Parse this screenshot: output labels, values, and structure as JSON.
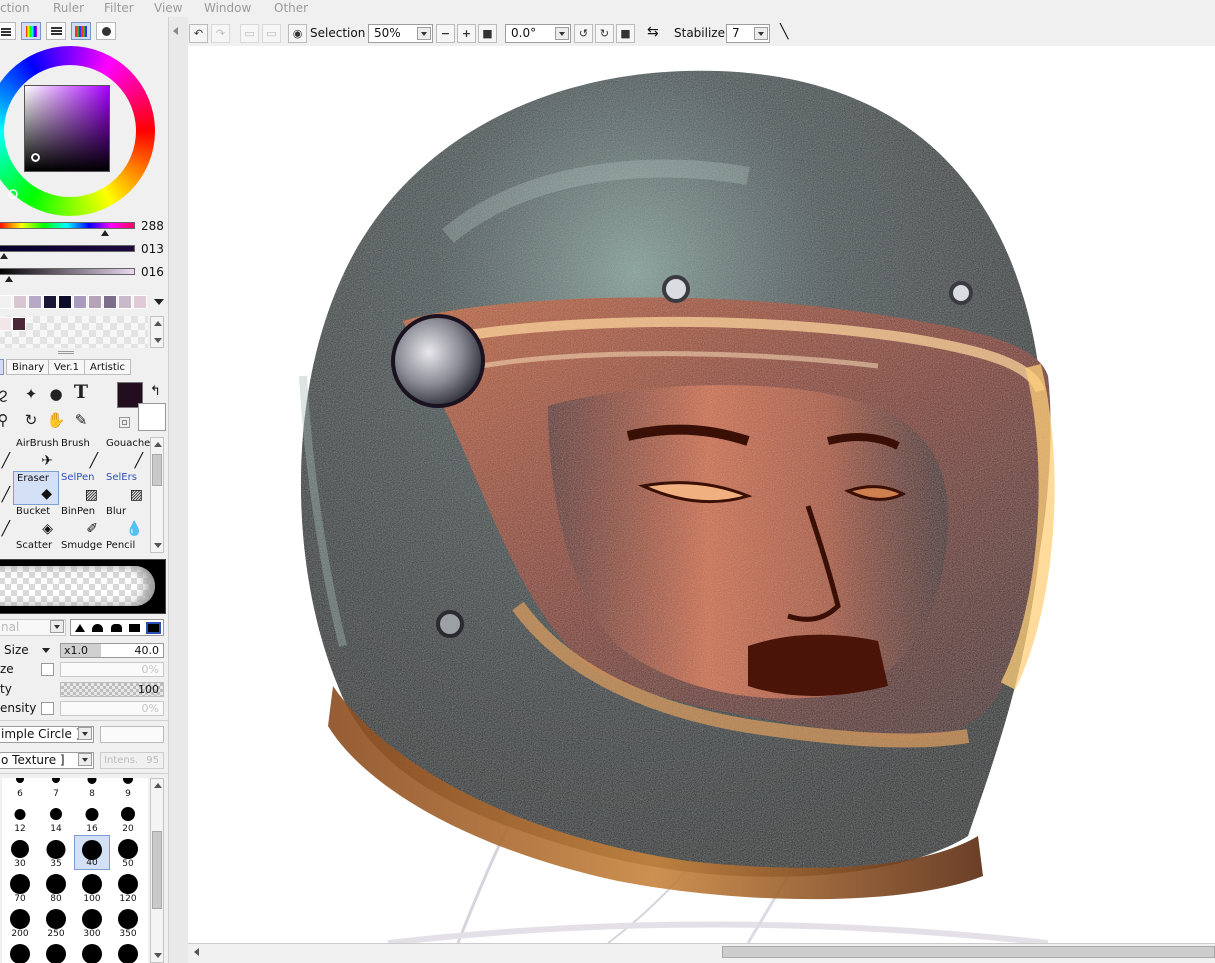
{
  "menu": [
    "ction",
    "Ruler",
    "Filter",
    "View",
    "Window",
    "Other"
  ],
  "color": {
    "hue_value": "288",
    "sat_value": "013",
    "val_value": "016",
    "primary_color": "#230e1f",
    "secondary_color": "#ffffff"
  },
  "palette_row1": [
    "#f0f0f0",
    "#d9c6d3",
    "#b6a8c6",
    "#1a1636",
    "#0d0b2a",
    "#a89bbd",
    "#b5a4b7",
    "#7c6d8a",
    "#c9b9c9",
    "#e0cad8"
  ],
  "palette_row2": [
    "#f3e6e8",
    "#4a2838"
  ],
  "tool_tabs": [
    "Binary",
    "Ver.1",
    "Artistic"
  ],
  "brushes": [
    [
      "AirBrush",
      "Brush",
      "Gouache"
    ],
    [
      "Eraser",
      "SelPen",
      "SelErs"
    ],
    [
      "Bucket",
      "BinPen",
      "Blur"
    ],
    [
      "Scatter",
      "Smudge",
      "Pencil"
    ]
  ],
  "brush_props": {
    "mode": "nal",
    "size_label": "Size",
    "size_multiplier": "x1.0",
    "size_value": "40.0",
    "min_size_label": "ze",
    "min_size_value": "0%",
    "density_label": "ty",
    "density_value": "100",
    "min_density_label": "ensity",
    "min_density_value": "0%",
    "shape": "imple Circle ]",
    "texture": "o Texture ]",
    "texture_intensity_label": "Intens.",
    "texture_intensity_value": "95"
  },
  "brush_sizes": [
    "6",
    "7",
    "8",
    "9",
    "12",
    "14",
    "16",
    "20",
    "30",
    "35",
    "40",
    "50",
    "70",
    "80",
    "100",
    "120",
    "200",
    "250",
    "300",
    "350"
  ],
  "brush_sizes_selected": "40",
  "toolbar": {
    "selection_label": "Selection",
    "zoom": "50%",
    "rotation": "0.0°",
    "stabilizer_label": "Stabilizer",
    "stabilizer_value": "7"
  }
}
